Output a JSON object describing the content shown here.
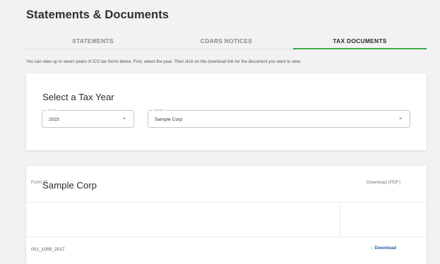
{
  "page": {
    "title": "Statements & Documents",
    "info_text": "You can view up to seven years of ICS tax forms below. First, select the year. Then click on the download link for the document you want to view."
  },
  "tabs": [
    {
      "label": "STATEMENTS",
      "active": false
    },
    {
      "label": "CDARS NOTICES",
      "active": false
    },
    {
      "label": "TAX DOCUMENTS",
      "active": true
    }
  ],
  "colors": {
    "accent_green": "#3fa84a",
    "link_blue": "#1e5aa8"
  },
  "tax_year_card": {
    "title": "Select a Tax Year",
    "tax_year_field": {
      "label": "Tax Year",
      "value": "2023"
    },
    "depositor_field": {
      "label": "Depositor",
      "value": "Sample Corp"
    }
  },
  "documents_card": {
    "title": "Sample Corp",
    "columns": {
      "form_id": "Form ID",
      "download": "Download (PDF)"
    },
    "sort_icon": "arrow-up-icon",
    "rows": [
      {
        "form_id": "001_1099_2017",
        "download_label": "Download",
        "download_icon": "download-arrow-icon"
      }
    ]
  }
}
